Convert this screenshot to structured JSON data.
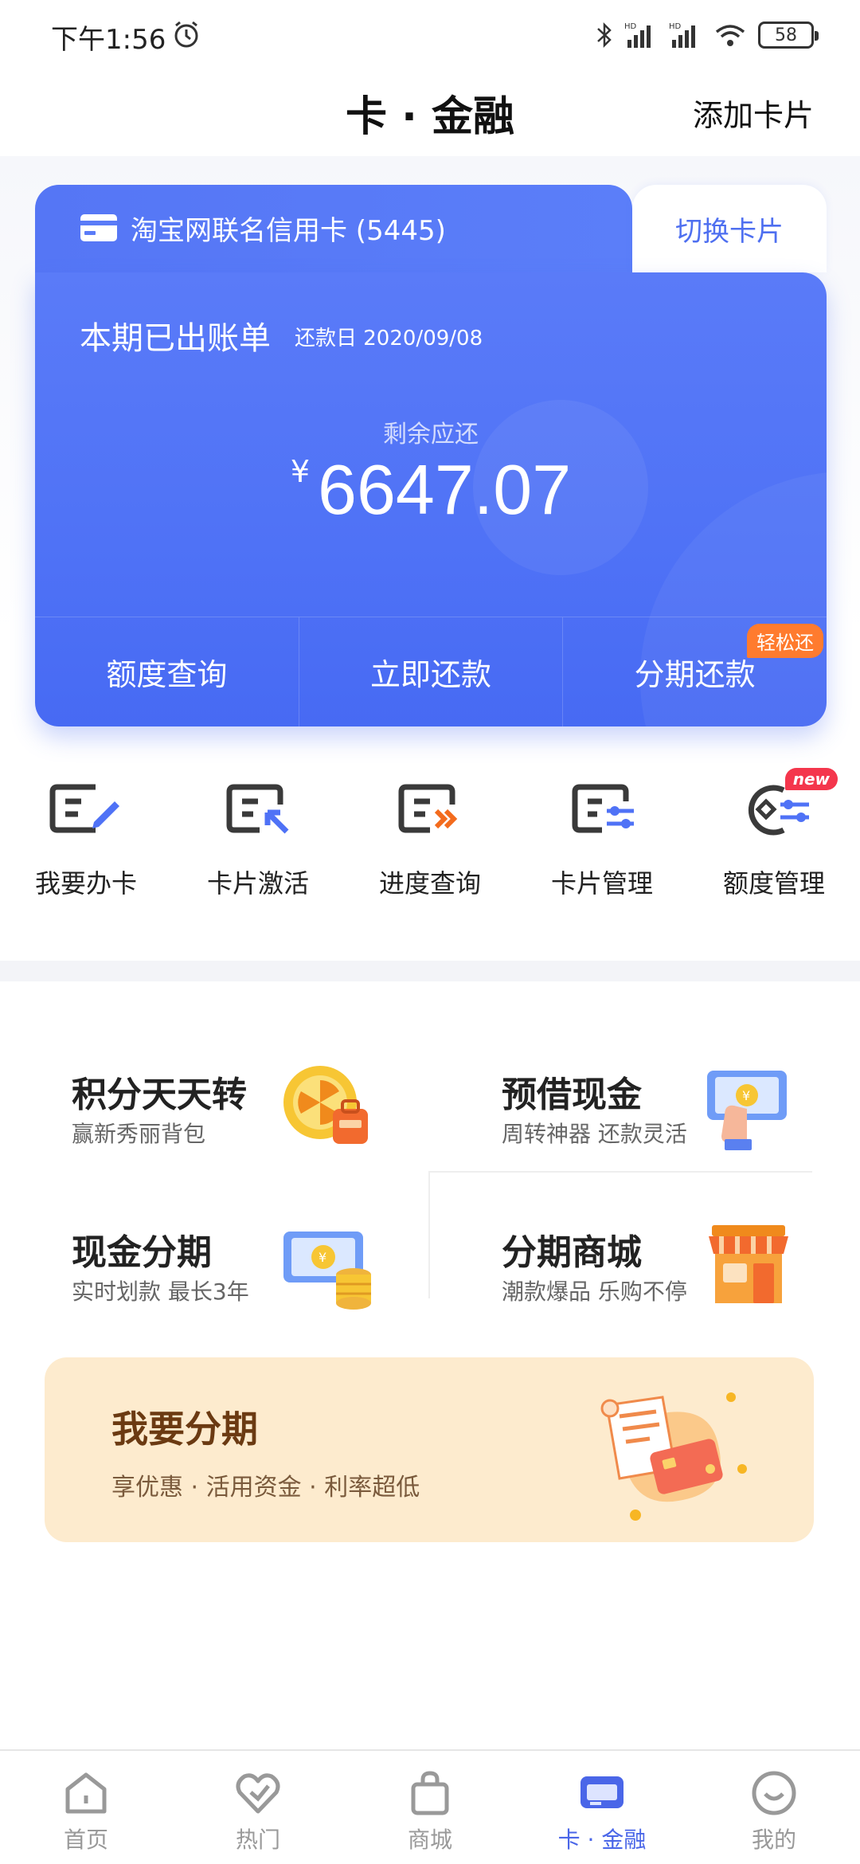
{
  "status": {
    "time": "下午1:56",
    "battery": "58"
  },
  "header": {
    "title": "卡 · 金融",
    "add_card": "添加卡片"
  },
  "card": {
    "name": "淘宝网联名信用卡 (5445)",
    "switch": "切换卡片",
    "bill_title": "本期已出账单",
    "due_date": "还款日 2020/09/08",
    "remaining_label": "剩余应还",
    "currency": "¥",
    "amount": "6647.07",
    "actions": [
      {
        "label": "额度查询"
      },
      {
        "label": "立即还款"
      },
      {
        "label": "分期还款",
        "badge": "轻松还"
      }
    ]
  },
  "quick": [
    {
      "label": "我要办卡",
      "icon": "card-edit-icon"
    },
    {
      "label": "卡片激活",
      "icon": "card-activate-icon"
    },
    {
      "label": "进度查询",
      "icon": "progress-icon"
    },
    {
      "label": "卡片管理",
      "icon": "card-settings-icon"
    },
    {
      "label": "额度管理",
      "icon": "limit-icon",
      "badge": "new"
    }
  ],
  "features": [
    {
      "title": "积分天天转",
      "subtitle": "赢新秀丽背包",
      "icon": "points-wheel-icon"
    },
    {
      "title": "预借现金",
      "subtitle": "周转神器 还款灵活",
      "icon": "cash-hand-icon"
    },
    {
      "title": "现金分期",
      "subtitle": "实时划款 最长3年",
      "icon": "cash-coins-icon"
    },
    {
      "title": "分期商城",
      "subtitle": "潮款爆品 乐购不停",
      "icon": "shop-icon"
    }
  ],
  "promo": {
    "title": "我要分期",
    "subtitle": "享优惠 · 活用资金 · 利率超低"
  },
  "nav": [
    {
      "label": "首页",
      "icon": "home-icon"
    },
    {
      "label": "热门",
      "icon": "heart-icon"
    },
    {
      "label": "商城",
      "icon": "shopping-bag-icon"
    },
    {
      "label": "卡 · 金融",
      "icon": "card-icon",
      "active": true
    },
    {
      "label": "我的",
      "icon": "profile-icon"
    }
  ],
  "colors": {
    "primary": "#4f72f6",
    "accent_orange": "#ff7b2e",
    "promo_bg": "#fdebce"
  }
}
